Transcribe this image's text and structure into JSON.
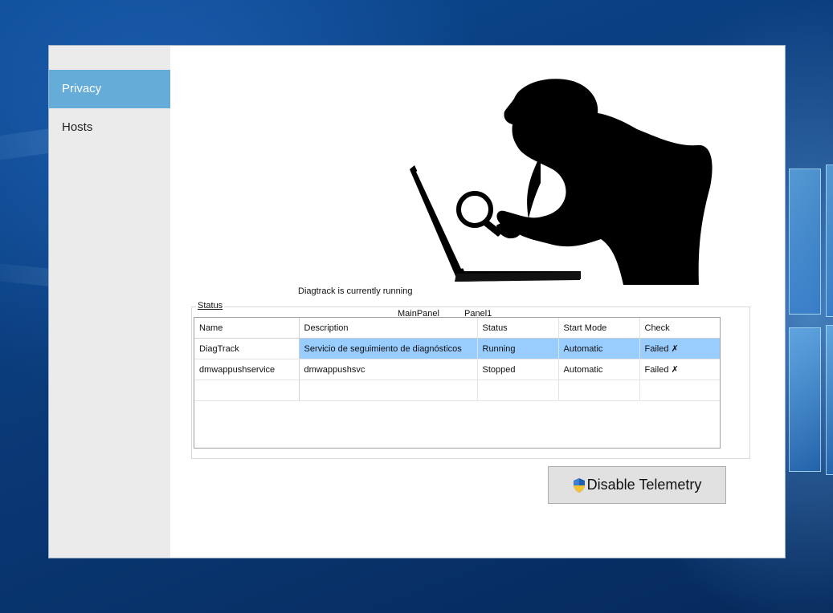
{
  "sidebar": {
    "items": [
      {
        "label": "Privacy",
        "active": true
      },
      {
        "label": "Hosts",
        "active": false
      }
    ]
  },
  "status_message": "Diagtrack is currently running",
  "panel_labels": [
    "MainPanel",
    "Panel1"
  ],
  "group": {
    "label": "Status"
  },
  "table": {
    "columns": [
      "Name",
      "Description",
      "Status",
      "Start Mode",
      "Check"
    ],
    "rows": [
      [
        "DiagTrack",
        "Servicio de seguimiento de diagnósticos",
        "Running",
        "Automatic",
        "Failed ✗"
      ],
      [
        "dmwappushservice",
        "dmwappushsvc",
        "Stopped",
        "Automatic",
        "Failed ✗"
      ]
    ]
  },
  "button": {
    "label": "Disable Telemetry",
    "icon": "uac-shield-icon"
  },
  "colors": {
    "selected_nav": "#66acd8",
    "selected_row": "#99ccff",
    "sidebar_bg": "#ebebeb"
  }
}
